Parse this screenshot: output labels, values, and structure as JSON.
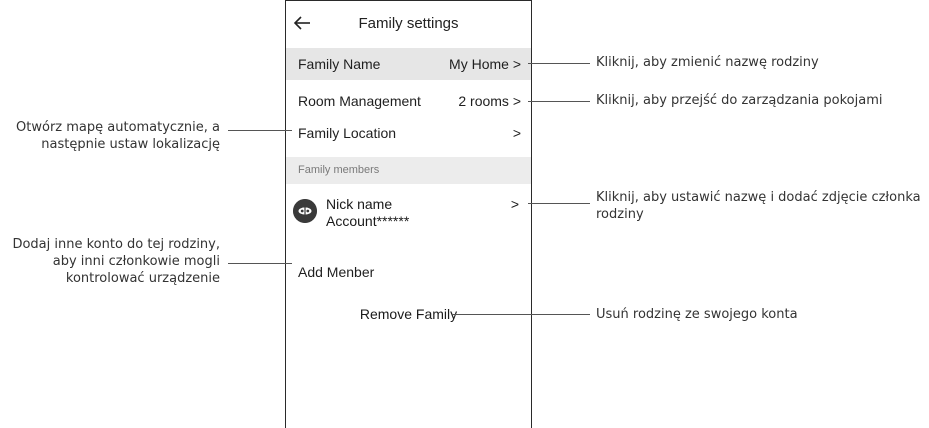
{
  "header": {
    "title": "Family settings"
  },
  "family_name_row": {
    "label": "Family Name",
    "value": "My Home >"
  },
  "room_management_row": {
    "label": "Room Management",
    "value": "2 rooms >"
  },
  "family_location_row": {
    "label": "Family Location",
    "value": ">"
  },
  "members_section": {
    "header": "Family members",
    "member": {
      "name": "Nick name",
      "account": "Account******",
      "chevron": ">"
    }
  },
  "add_member": {
    "label": "Add Menber"
  },
  "remove_family": {
    "label": "Remove Family"
  },
  "annotations": {
    "family_name": "Kliknij, aby zmienić nazwę rodziny",
    "room_management": "Kliknij, aby przejść do zarządzania pokojami",
    "family_location_line1": "Otwórz mapę automatycznie, a",
    "family_location_line2": "następnie ustaw lokalizację",
    "member_line1": "Kliknij, aby ustawić nazwę i dodać zdjęcie członka",
    "member_line2": "rodziny",
    "add_member_line1": "Dodaj inne konto do tej rodziny,",
    "add_member_line2": "aby inni członkowie mogli",
    "add_member_line3": "kontrolować urządzenie",
    "remove_family": "Usuń rodzinę ze swojego konta"
  },
  "icons": {
    "back": "arrow-left-icon",
    "avatar": "user-avatar-icon"
  },
  "colors": {
    "highlight_row": "#e6e6e6",
    "section_header": "#ececec",
    "avatar": "#3a3a3a"
  }
}
